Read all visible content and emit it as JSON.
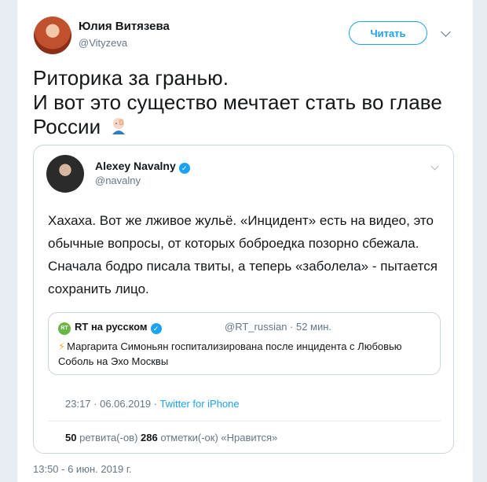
{
  "tweet": {
    "author_name": "Юлия Витязева",
    "author_handle": "@Vityzeva",
    "follow_label": "Читать",
    "text_line1": "Риторика за гранью.",
    "text_line2": "И вот это существо мечтает стать во главе",
    "text_line3": "России",
    "date": "13:50 - 6 июн. 2019 г."
  },
  "quote": {
    "author_name": "Alexey Navalny",
    "author_handle": "@navalny",
    "text": "Хахаха. Вот же лживое жульё. «Инцидент» есть на видео, это обычные вопросы, от которых боброедка позорно сбежала. Сначала бодро писала твиты, а теперь «заболела» -  пытается сохранить лицо.",
    "timestamp": "23:17 · 06.06.2019 ·",
    "client": "Twitter for iPhone",
    "retweets_count": "50",
    "retweets_label": "ретвита(-ов)",
    "likes_count": "286",
    "likes_label": "отметки(-ок) «Нравится»",
    "inner": {
      "author_name": "RT на русском",
      "meta": "@RT_russian · 52 мин.",
      "text": "Маргарита Симоньян госпитализирована после инцидента с Любовью Соболь на Эхо Москвы",
      "logo_text": "RT"
    }
  },
  "icons": {
    "verified": "✓",
    "bolt": "⚡"
  },
  "colors": {
    "accent": "#1da1f2",
    "secondary_text": "#657786",
    "rt_green": "#6ab543"
  }
}
